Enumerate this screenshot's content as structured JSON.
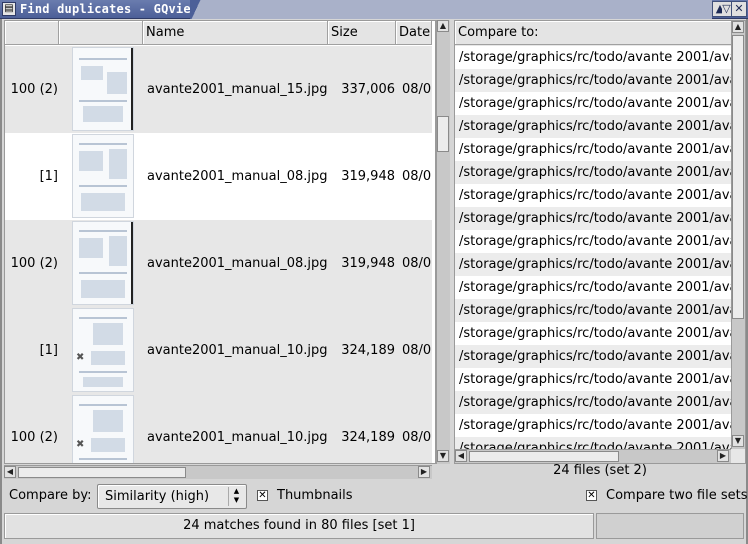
{
  "window": {
    "title": "Find duplicates - GQview",
    "menu_icon": "window-menu-icon",
    "buttons": [
      "minimize-icon",
      "maximize-icon",
      "close-icon"
    ]
  },
  "left_list": {
    "columns": {
      "rank": "",
      "thumb": "",
      "name": "Name",
      "size": "Size",
      "date": "Date"
    },
    "rows": [
      {
        "rank": "100 (2)",
        "name": "avante2001_manual_15.jpg",
        "size": "337,006",
        "date": "08/0("
      },
      {
        "rank": "[1]",
        "name": "avante2001_manual_08.jpg",
        "size": "319,948",
        "date": "08/0("
      },
      {
        "rank": "100 (2)",
        "name": "avante2001_manual_08.jpg",
        "size": "319,948",
        "date": "08/0("
      },
      {
        "rank": "[1]",
        "name": "avante2001_manual_10.jpg",
        "size": "324,189",
        "date": "08/0("
      },
      {
        "rank": "100 (2)",
        "name": "avante2001_manual_10.jpg",
        "size": "324,189",
        "date": "08/0("
      }
    ]
  },
  "right_list": {
    "header": "Compare to:",
    "rows": [
      "/storage/graphics/rc/todo/avante 2001/ava",
      "/storage/graphics/rc/todo/avante 2001/ava",
      "/storage/graphics/rc/todo/avante 2001/ava",
      "/storage/graphics/rc/todo/avante 2001/ava",
      "/storage/graphics/rc/todo/avante 2001/ava",
      "/storage/graphics/rc/todo/avante 2001/ava",
      "/storage/graphics/rc/todo/avante 2001/ava",
      "/storage/graphics/rc/todo/avante 2001/ava",
      "/storage/graphics/rc/todo/avante 2001/ava",
      "/storage/graphics/rc/todo/avante 2001/ava",
      "/storage/graphics/rc/todo/avante 2001/ava",
      "/storage/graphics/rc/todo/avante 2001/ava",
      "/storage/graphics/rc/todo/avante 2001/ava",
      "/storage/graphics/rc/todo/avante 2001/ava",
      "/storage/graphics/rc/todo/avante 2001/ava",
      "/storage/graphics/rc/todo/avante 2001/ava",
      "/storage/graphics/rc/todo/avante 2001/ava",
      "/storage/graphics/rc/todo/avante 2001/ava"
    ],
    "status": "24 files (set 2)"
  },
  "controls": {
    "compare_by_label": "Compare by:",
    "compare_by_value": "Similarity (high)",
    "thumbnails_label": "Thumbnails",
    "thumbnails_checked": true,
    "compare_two_sets_label": "Compare two file sets",
    "compare_two_sets_checked": true
  },
  "statusbar": {
    "text": "24 matches found in 80 files [set 1]"
  }
}
